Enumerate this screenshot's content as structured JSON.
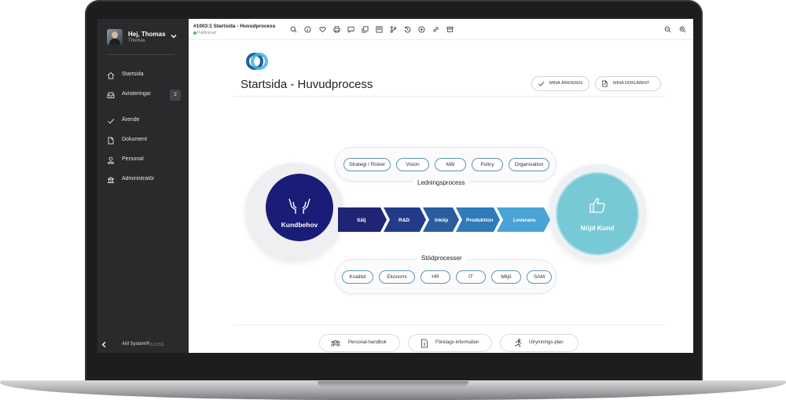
{
  "sidebar": {
    "user": {
      "greeting": "Hej, Thomas",
      "name": "Thomas"
    },
    "items": [
      {
        "label": "Startsida",
        "icon": "home-icon"
      },
      {
        "label": "Avisteringar",
        "icon": "inbox-icon",
        "badge": "2"
      },
      {
        "label": "Ärende",
        "icon": "check-icon"
      },
      {
        "label": "Dokument",
        "icon": "document-icon"
      },
      {
        "label": "Personal",
        "icon": "person-icon"
      },
      {
        "label": "Administratör",
        "icon": "admin-icon"
      }
    ],
    "footer": {
      "app_name": "AM System®",
      "version": "6.2.013"
    }
  },
  "topbar": {
    "doc_title": "#1003:1 Startsida - Huvudprocess",
    "status": "Publicerad",
    "toolbar_icons": [
      "search-icon",
      "info-icon",
      "heart-icon",
      "print-icon",
      "comment-icon",
      "copy-icon",
      "archive-icon",
      "branch-icon",
      "history-icon",
      "add-icon",
      "link-icon",
      "box-icon"
    ],
    "zoom_icons": [
      "zoom-out-icon",
      "zoom-in-icon"
    ]
  },
  "page": {
    "title": "Startsida - Huvudprocess",
    "buttons": {
      "my_cases": "MINA ÄRENDEN",
      "my_documents": "MINA DOKUMENT"
    }
  },
  "process": {
    "management": {
      "label": "Ledningsprocess",
      "items": [
        "Strategi / Risker",
        "Vision",
        "Mål",
        "Policy",
        "Organisation"
      ]
    },
    "support": {
      "label": "Stödprocesser",
      "items": [
        "Kvalitet",
        "Ekonomi",
        "HR",
        "IT",
        "Miljö",
        "SAM"
      ]
    },
    "core": [
      "Sälj",
      "R&D",
      "Inköp",
      "Produktion",
      "Leverans"
    ],
    "input": "Kundbehov",
    "output": "Nöjd Kund"
  },
  "links": [
    "Personal-handbok",
    "Företags-information",
    "Utrymnings-plan"
  ],
  "colors": {
    "sidebar_bg": "#2a2a2c",
    "navy": "#1a1d78",
    "chevron_1": "#1f2475",
    "chevron_2": "#233a8a",
    "chevron_3": "#2a5da0",
    "chevron_4": "#2f7ab8",
    "chevron_5": "#4aa3d6",
    "teal": "#78c9d6",
    "pill_border": "#5d97ab"
  }
}
